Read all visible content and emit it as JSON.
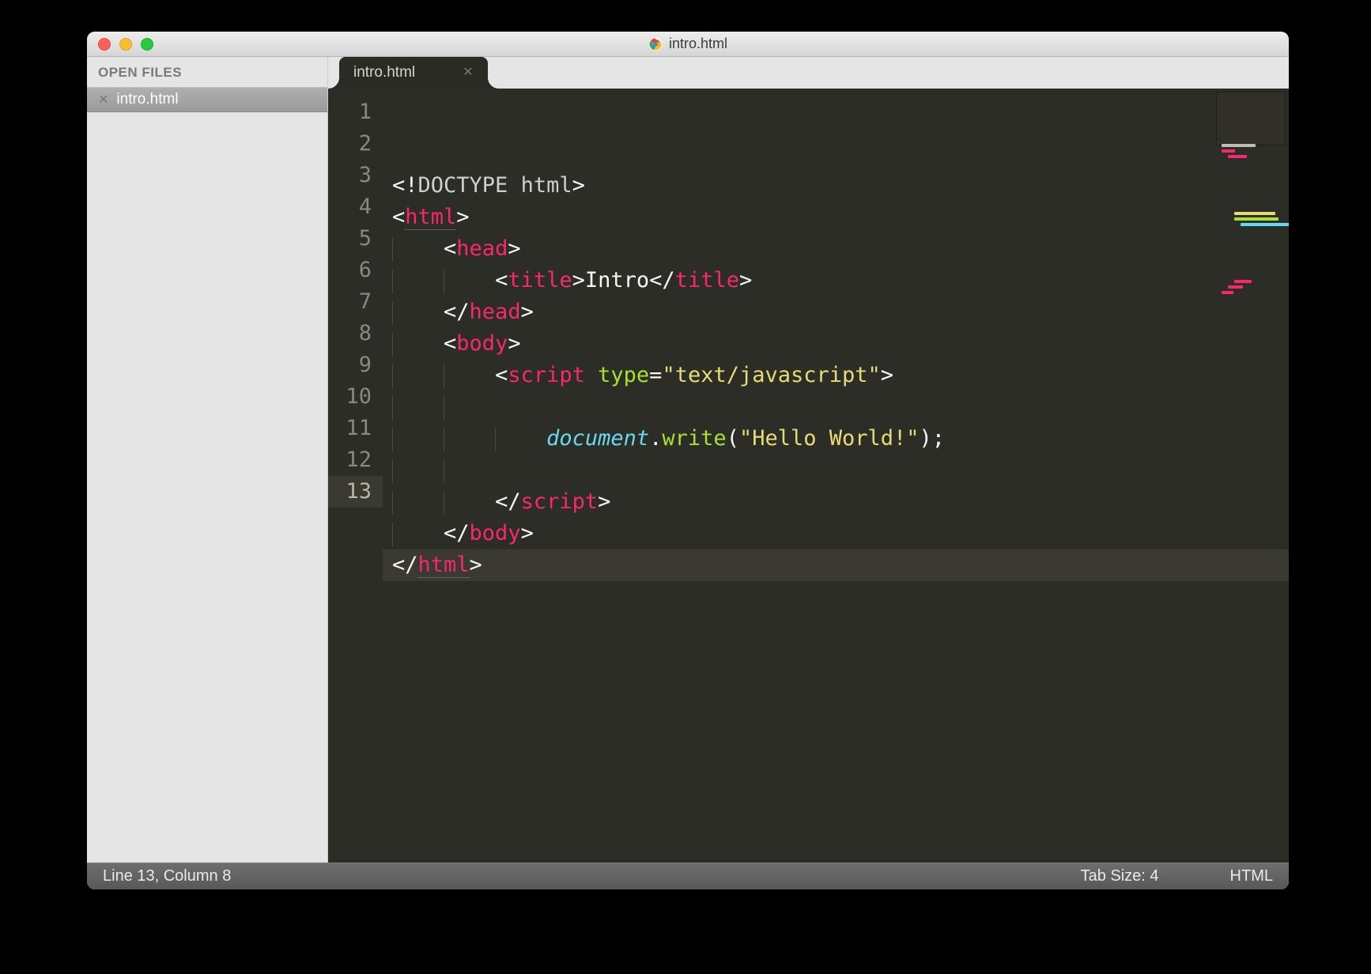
{
  "window": {
    "title": "intro.html"
  },
  "sidebar": {
    "header": "OPEN FILES",
    "files": [
      {
        "name": "intro.html"
      }
    ]
  },
  "tabs": [
    {
      "label": "intro.html",
      "active": true
    }
  ],
  "editor": {
    "active_line": 13,
    "lines": [
      {
        "n": 1,
        "tokens": [
          {
            "t": "<!",
            "c": "p"
          },
          {
            "t": "DOCTYPE",
            "c": "docgrey"
          },
          {
            "t": " ",
            "c": "p"
          },
          {
            "t": "html",
            "c": "docgrey"
          },
          {
            "t": ">",
            "c": "p"
          }
        ]
      },
      {
        "n": 2,
        "tokens": [
          {
            "t": "<",
            "c": "p"
          },
          {
            "t": "html",
            "c": "tagn",
            "ul": true
          },
          {
            "t": ">",
            "c": "p"
          }
        ]
      },
      {
        "n": 3,
        "indent": 1,
        "tokens": [
          {
            "t": "<",
            "c": "p"
          },
          {
            "t": "head",
            "c": "tagn"
          },
          {
            "t": ">",
            "c": "p"
          }
        ]
      },
      {
        "n": 4,
        "indent": 2,
        "tokens": [
          {
            "t": "<",
            "c": "p"
          },
          {
            "t": "title",
            "c": "tagn"
          },
          {
            "t": ">",
            "c": "p"
          },
          {
            "t": "Intro",
            "c": "p"
          },
          {
            "t": "</",
            "c": "p"
          },
          {
            "t": "title",
            "c": "tagn"
          },
          {
            "t": ">",
            "c": "p"
          }
        ]
      },
      {
        "n": 5,
        "indent": 1,
        "tokens": [
          {
            "t": "</",
            "c": "p"
          },
          {
            "t": "head",
            "c": "tagn"
          },
          {
            "t": ">",
            "c": "p"
          }
        ]
      },
      {
        "n": 6,
        "indent": 1,
        "tokens": [
          {
            "t": "<",
            "c": "p"
          },
          {
            "t": "body",
            "c": "tagn"
          },
          {
            "t": ">",
            "c": "p"
          }
        ]
      },
      {
        "n": 7,
        "indent": 2,
        "tokens": [
          {
            "t": "<",
            "c": "p"
          },
          {
            "t": "script",
            "c": "tagn"
          },
          {
            "t": " ",
            "c": "p"
          },
          {
            "t": "type",
            "c": "attr"
          },
          {
            "t": "=",
            "c": "p"
          },
          {
            "t": "\"text/javascript\"",
            "c": "str"
          },
          {
            "t": ">",
            "c": "p"
          }
        ]
      },
      {
        "n": 8,
        "indent": 2,
        "tokens": []
      },
      {
        "n": 9,
        "indent": 3,
        "tokens": [
          {
            "t": "document",
            "c": "obj"
          },
          {
            "t": ".",
            "c": "p"
          },
          {
            "t": "write",
            "c": "fn"
          },
          {
            "t": "(",
            "c": "p"
          },
          {
            "t": "\"Hello World!\"",
            "c": "str"
          },
          {
            "t": ")",
            "c": "p"
          },
          {
            "t": ";",
            "c": "p"
          }
        ]
      },
      {
        "n": 10,
        "indent": 2,
        "tokens": []
      },
      {
        "n": 11,
        "indent": 2,
        "tokens": [
          {
            "t": "</",
            "c": "p"
          },
          {
            "t": "script",
            "c": "tagn"
          },
          {
            "t": ">",
            "c": "p"
          }
        ]
      },
      {
        "n": 12,
        "indent": 1,
        "tokens": [
          {
            "t": "</",
            "c": "p"
          },
          {
            "t": "body",
            "c": "tagn"
          },
          {
            "t": ">",
            "c": "p"
          }
        ]
      },
      {
        "n": 13,
        "tokens": [
          {
            "t": "</",
            "c": "p"
          },
          {
            "t": "html",
            "c": "tagn",
            "ul": true
          },
          {
            "t": ">",
            "c": "p"
          }
        ]
      }
    ]
  },
  "status": {
    "position": "Line 13, Column 8",
    "tabsize": "Tab Size: 4",
    "syntax": "HTML"
  }
}
